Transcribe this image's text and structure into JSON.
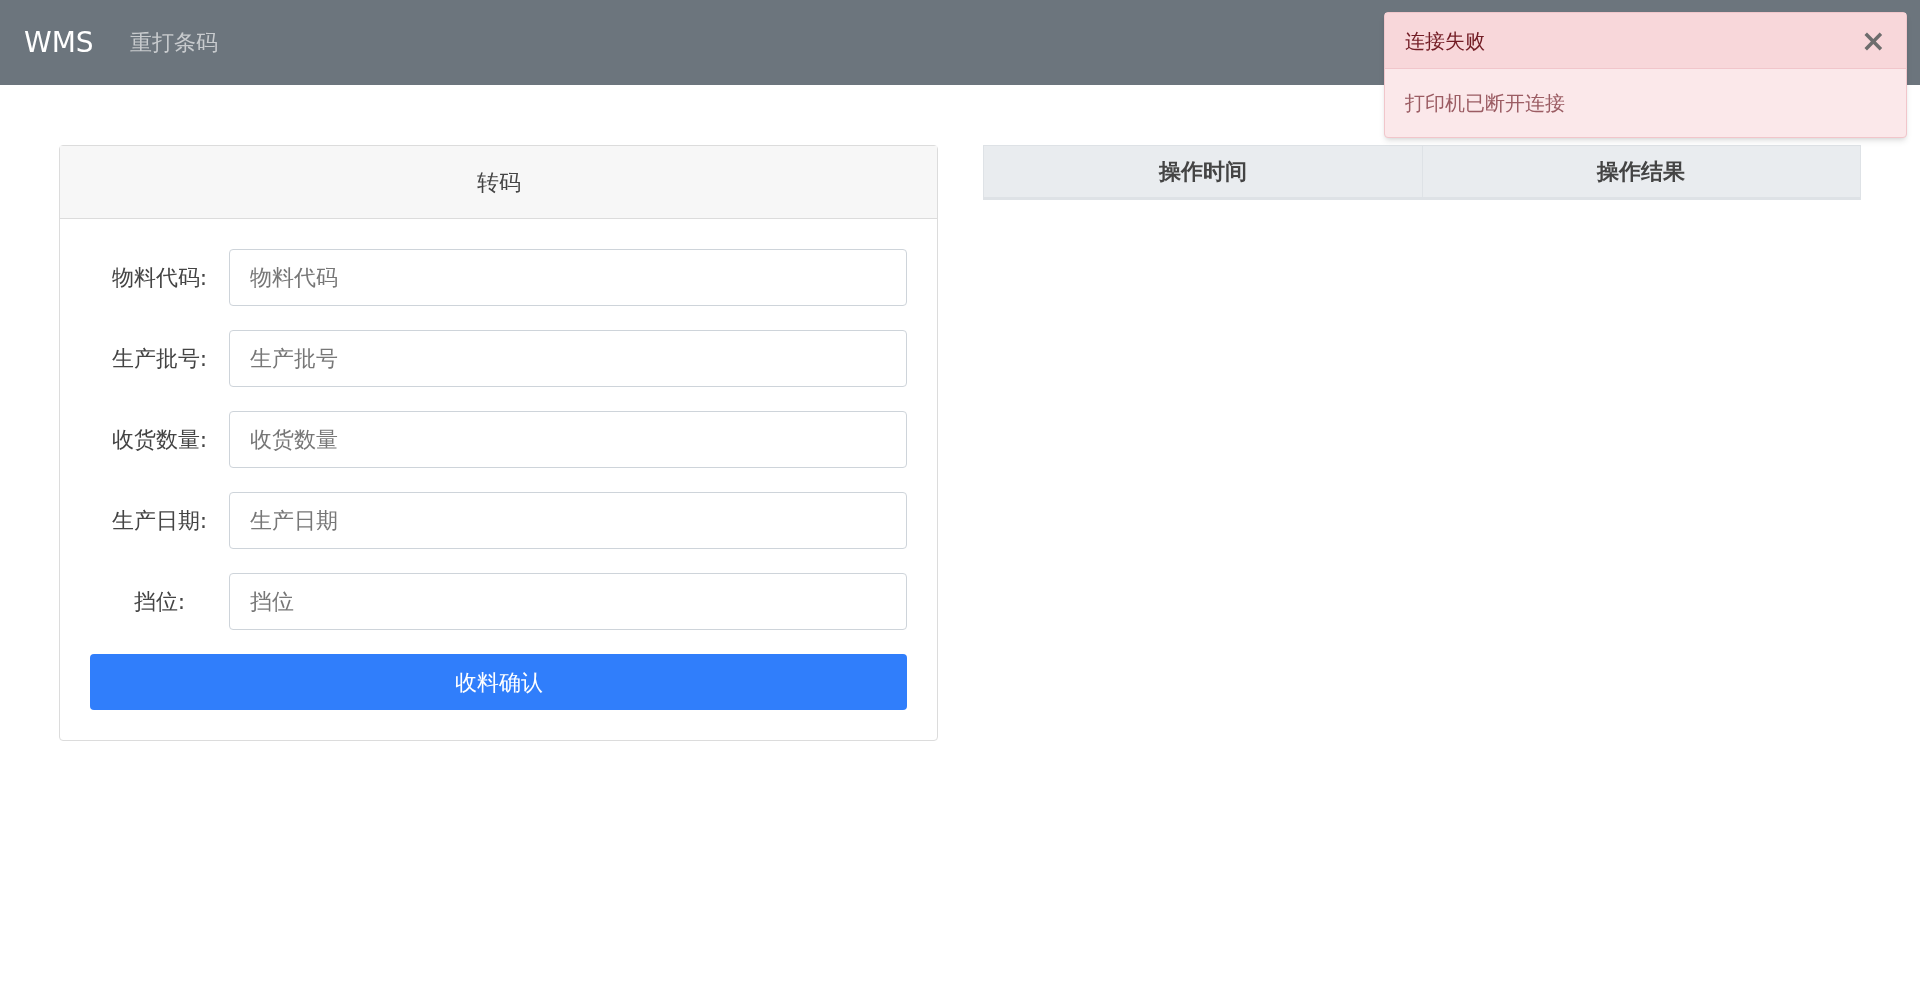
{
  "navbar": {
    "brand": "WMS",
    "links": [
      {
        "label": "重打条码"
      }
    ]
  },
  "form": {
    "title": "转码",
    "fields": [
      {
        "label": "物料代码:",
        "placeholder": "物料代码"
      },
      {
        "label": "生产批号:",
        "placeholder": "生产批号"
      },
      {
        "label": "收货数量:",
        "placeholder": "收货数量"
      },
      {
        "label": "生产日期:",
        "placeholder": "生产日期"
      },
      {
        "label": "挡位:",
        "placeholder": "挡位"
      }
    ],
    "submit": "收料确认"
  },
  "table": {
    "columns": [
      "操作时间",
      "操作结果"
    ]
  },
  "toast": {
    "title": "连接失败",
    "close": "×",
    "message": "打印机已断开连接"
  }
}
